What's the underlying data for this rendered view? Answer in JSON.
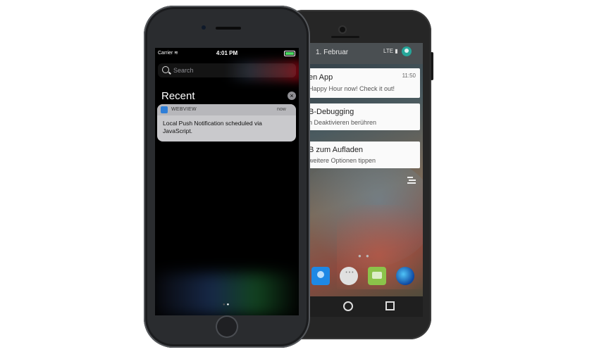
{
  "android": {
    "status_date": "1. Februar",
    "status_icons": "LTE ▮",
    "notifications": [
      {
        "title": "en App",
        "subtitle": "Happy Hour now! Check it out!",
        "time": "11:50"
      },
      {
        "title": "B-Debugging",
        "subtitle": "n Deaktivieren berühren",
        "time": ""
      },
      {
        "title": "B zum Aufladen",
        "subtitle": "weitere Optionen tippen",
        "time": ""
      }
    ],
    "page_dots": "● ●",
    "apps": [
      "contacts-app-icon",
      "app-drawer-icon",
      "messaging-app-icon",
      "browser-app-icon"
    ]
  },
  "iphone": {
    "carrier": "Carrier",
    "wifi_icon": "wifi-icon",
    "time": "4:01 PM",
    "search_placeholder": "Search",
    "section_title": "Recent",
    "close_glyph": "×",
    "notification": {
      "app_name": "WEBVIEW",
      "time": "now",
      "body": "Local Push Notification scheduled via JavaScript."
    }
  }
}
